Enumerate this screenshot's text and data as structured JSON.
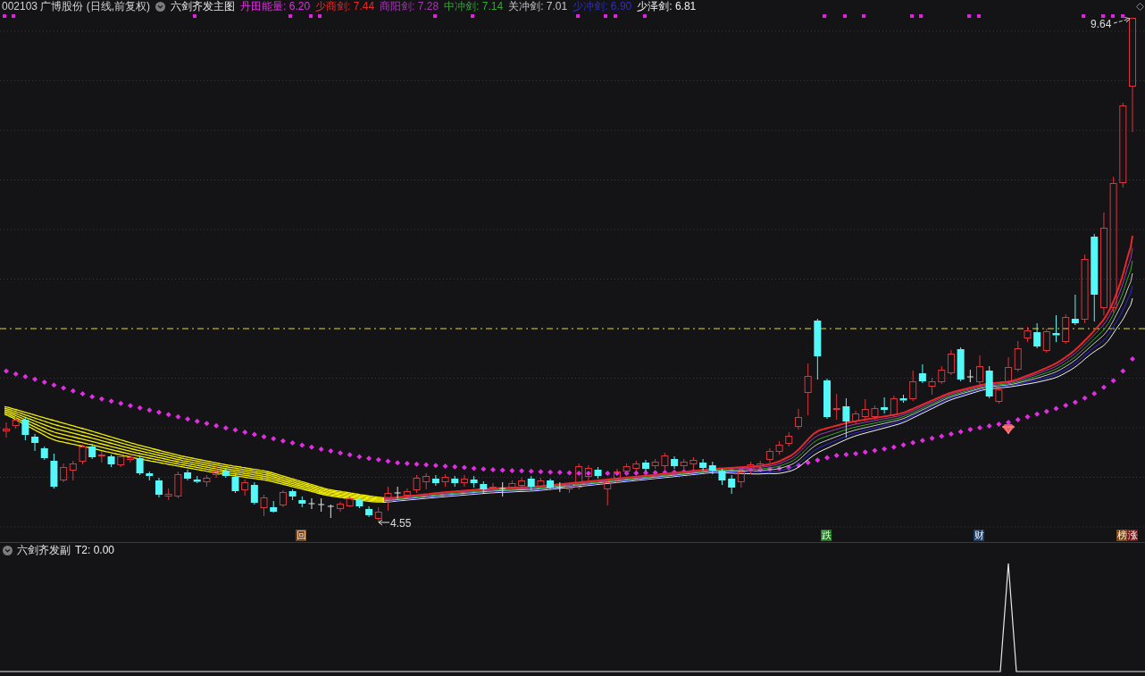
{
  "header": {
    "symbol": "002103 广博股份 (日线,前复权)",
    "indicator": "六剑齐发主图",
    "readouts": [
      {
        "text": "丹田能量: 6.20",
        "color": "#e22ee2",
        "kind": "dots"
      },
      {
        "text": "少商剑: 7.44",
        "color": "#e62a2a",
        "kind": "line"
      },
      {
        "text": "商阳剑: 7.28",
        "color": "#a838b8",
        "kind": "line"
      },
      {
        "text": "中冲剑: 7.14",
        "color": "#2eaa2e",
        "kind": "line"
      },
      {
        "text": "关冲剑: 7.01",
        "color": "#c4c4c4",
        "kind": "line"
      },
      {
        "text": "少冲剑: 6.90",
        "color": "#2c2cd6",
        "kind": "line"
      },
      {
        "text": "少泽剑: 6.81",
        "color": "#f2f2f2",
        "kind": "line"
      }
    ]
  },
  "main_chart": {
    "high_label": "9.64",
    "low_label": "4.55",
    "events": [
      {
        "label": "回",
        "color": "#7b4613"
      },
      {
        "label": "跌",
        "color": "#1e7a1e"
      },
      {
        "label": "财",
        "color": "#1d3f6b"
      },
      {
        "label": "榜",
        "color": "#7b4813"
      },
      {
        "label": "涨",
        "color": "#7a1616"
      }
    ]
  },
  "sub_panel": {
    "indicator": "六剑齐发副",
    "readout": "T2: 0.00"
  }
}
